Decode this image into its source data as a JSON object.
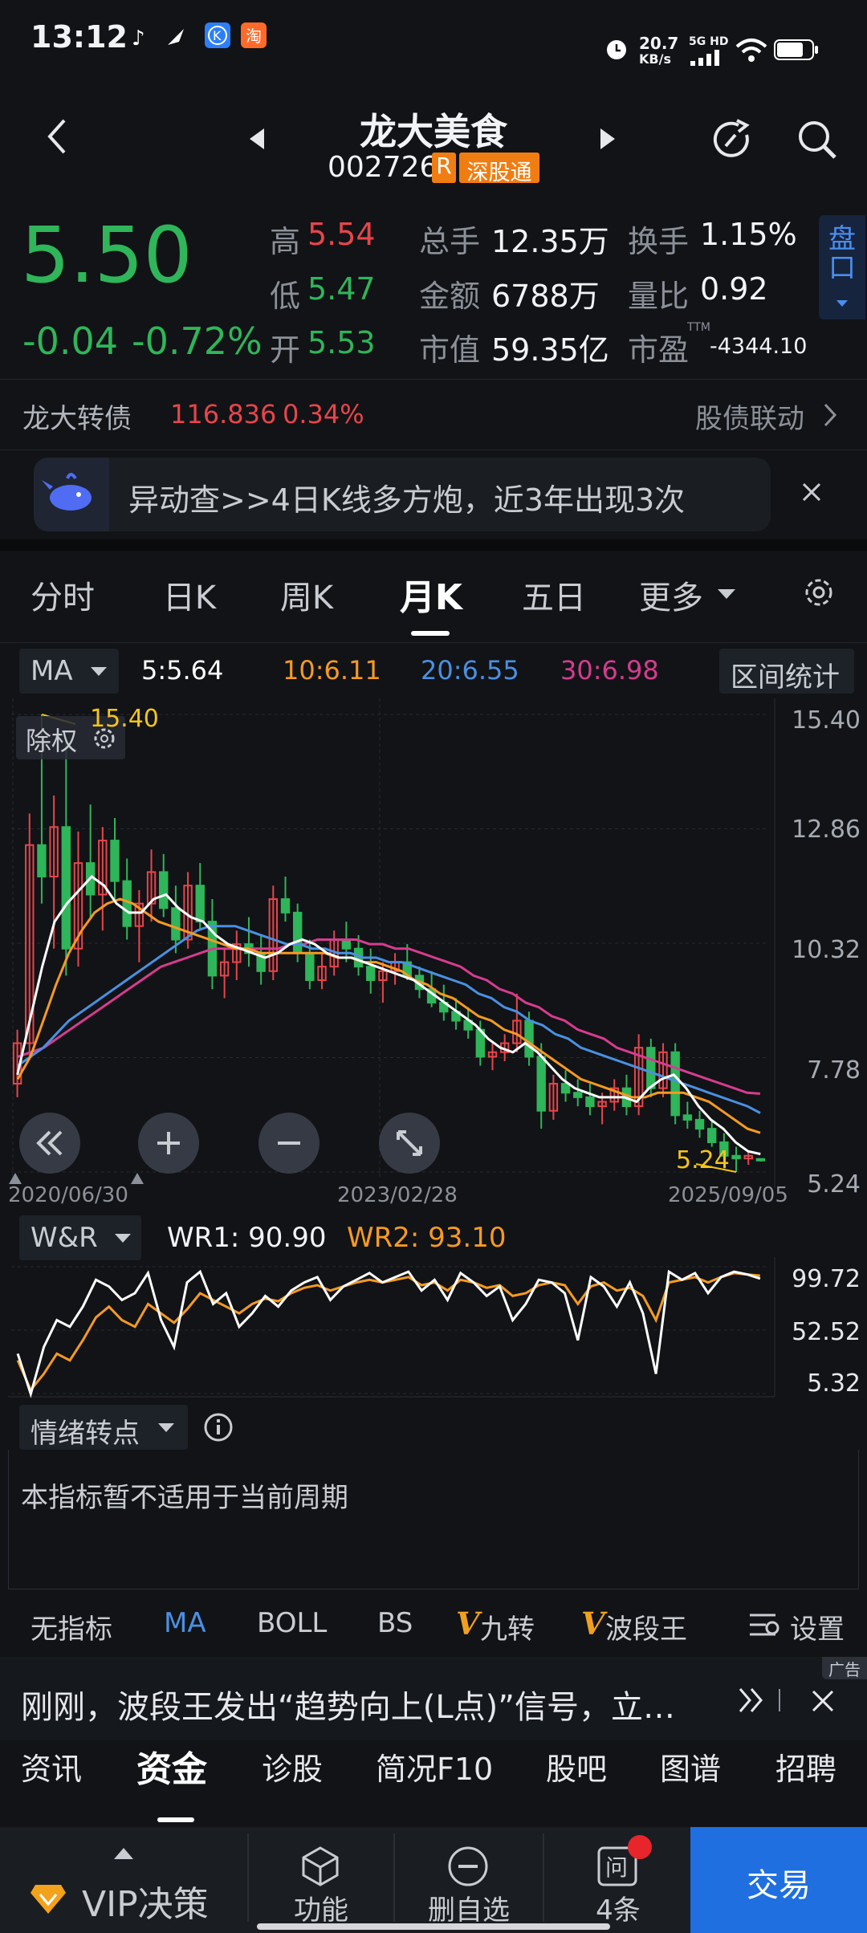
{
  "status_bar": {
    "time": "13:12",
    "net_speed_top": "20.7",
    "net_speed_bottom": "KB/s",
    "net_type": "5G HD",
    "icons": [
      "tiktok-icon",
      "feather-icon",
      "k-app-icon",
      "taobao-icon",
      "alarm-icon",
      "signal-icon",
      "wifi-icon",
      "battery-icon"
    ]
  },
  "header": {
    "name": "龙大美食",
    "code": "002726",
    "badge_r": "R",
    "badge_connect": "深股通"
  },
  "quote": {
    "price": "5.50",
    "change": "-0.04",
    "change_pct": "-0.72%",
    "high_label": "高",
    "high": "5.54",
    "low_label": "低",
    "low": "5.47",
    "open_label": "开",
    "open": "5.53",
    "volume_label": "总手",
    "volume": "12.35万",
    "amount_label": "金额",
    "amount": "6788万",
    "cap_label": "市值",
    "cap": "59.35亿",
    "turnover_label": "换手",
    "turnover": "1.15%",
    "vol_ratio_label": "量比",
    "vol_ratio": "0.92",
    "pe_label": "市盈",
    "pe_sup": "TTM",
    "pe": "-4344.10",
    "side_tab": "盘口"
  },
  "bond": {
    "name": "龙大转债",
    "price": "116.836",
    "pct": "0.34%",
    "link": "股债联动"
  },
  "alert": {
    "text": "异动查>>4日K线多方炮，近3年出现3次"
  },
  "period_tabs": [
    "分时",
    "日K",
    "周K",
    "月K",
    "五日",
    "更多"
  ],
  "active_tab": "月K",
  "ma_bar": {
    "selector": "MA",
    "ma5": "5:5.64",
    "ma10": "10:6.11",
    "ma20": "20:6.55",
    "ma30": "30:6.98",
    "range_stats": "区间统计"
  },
  "chart_overlay": {
    "adjust": "除权",
    "max_label": "15.40",
    "min_label": "5.24"
  },
  "chart_data": [
    {
      "type": "candlestick",
      "x": [
        "2020/06/30",
        "2023/02/28",
        "2025/09/05"
      ],
      "y_ticks": [
        "15.40",
        "12.86",
        "10.32",
        "7.78",
        "5.24"
      ],
      "ylim": [
        5.24,
        15.4
      ],
      "candles": [
        {
          "o": 7.2,
          "h": 8.4,
          "l": 6.9,
          "c": 8.1
        },
        {
          "o": 8.1,
          "h": 13.2,
          "l": 7.8,
          "c": 12.5
        },
        {
          "o": 12.5,
          "h": 15.4,
          "l": 11.2,
          "c": 11.8
        },
        {
          "o": 11.8,
          "h": 13.6,
          "l": 10.2,
          "c": 12.9
        },
        {
          "o": 12.9,
          "h": 14.9,
          "l": 9.6,
          "c": 10.2
        },
        {
          "o": 10.2,
          "h": 12.8,
          "l": 9.8,
          "c": 12.1
        },
        {
          "o": 12.1,
          "h": 13.4,
          "l": 10.9,
          "c": 11.4
        },
        {
          "o": 11.4,
          "h": 12.9,
          "l": 10.6,
          "c": 12.6
        },
        {
          "o": 12.6,
          "h": 13.1,
          "l": 11.3,
          "c": 11.7
        },
        {
          "o": 11.7,
          "h": 12.2,
          "l": 10.4,
          "c": 10.7
        },
        {
          "o": 10.7,
          "h": 11.5,
          "l": 9.9,
          "c": 11.2
        },
        {
          "o": 11.2,
          "h": 12.4,
          "l": 10.8,
          "c": 11.9
        },
        {
          "o": 11.9,
          "h": 12.3,
          "l": 10.9,
          "c": 11.1
        },
        {
          "o": 11.1,
          "h": 11.6,
          "l": 10.1,
          "c": 10.4
        },
        {
          "o": 10.4,
          "h": 11.9,
          "l": 10.2,
          "c": 11.6
        },
        {
          "o": 11.6,
          "h": 12.1,
          "l": 10.6,
          "c": 10.8
        },
        {
          "o": 10.8,
          "h": 11.3,
          "l": 9.3,
          "c": 9.6
        },
        {
          "o": 9.6,
          "h": 10.2,
          "l": 9.1,
          "c": 9.9
        },
        {
          "o": 9.9,
          "h": 10.6,
          "l": 9.5,
          "c": 10.3
        },
        {
          "o": 10.3,
          "h": 10.9,
          "l": 9.8,
          "c": 10.1
        },
        {
          "o": 10.1,
          "h": 10.5,
          "l": 9.4,
          "c": 9.7
        },
        {
          "o": 9.7,
          "h": 11.6,
          "l": 9.5,
          "c": 11.3
        },
        {
          "o": 11.3,
          "h": 11.8,
          "l": 10.8,
          "c": 11.0
        },
        {
          "o": 11.0,
          "h": 11.2,
          "l": 9.9,
          "c": 10.1
        },
        {
          "o": 10.1,
          "h": 10.4,
          "l": 9.3,
          "c": 9.5
        },
        {
          "o": 9.5,
          "h": 10.1,
          "l": 9.3,
          "c": 9.8
        },
        {
          "o": 9.8,
          "h": 10.6,
          "l": 9.6,
          "c": 10.4
        },
        {
          "o": 10.4,
          "h": 10.8,
          "l": 9.9,
          "c": 10.2
        },
        {
          "o": 10.2,
          "h": 10.5,
          "l": 9.6,
          "c": 9.8
        },
        {
          "o": 9.8,
          "h": 10.2,
          "l": 9.2,
          "c": 9.5
        },
        {
          "o": 9.5,
          "h": 9.9,
          "l": 9.0,
          "c": 9.7
        },
        {
          "o": 9.7,
          "h": 10.1,
          "l": 9.4,
          "c": 9.9
        },
        {
          "o": 9.9,
          "h": 10.3,
          "l": 9.5,
          "c": 9.6
        },
        {
          "o": 9.6,
          "h": 9.8,
          "l": 9.1,
          "c": 9.3
        },
        {
          "o": 9.3,
          "h": 9.7,
          "l": 8.9,
          "c": 9.0
        },
        {
          "o": 9.0,
          "h": 9.4,
          "l": 8.6,
          "c": 8.8
        },
        {
          "o": 8.8,
          "h": 9.1,
          "l": 8.4,
          "c": 8.6
        },
        {
          "o": 8.6,
          "h": 8.9,
          "l": 8.2,
          "c": 8.4
        },
        {
          "o": 8.4,
          "h": 8.6,
          "l": 7.6,
          "c": 7.8
        },
        {
          "o": 7.8,
          "h": 8.1,
          "l": 7.5,
          "c": 7.9
        },
        {
          "o": 7.9,
          "h": 8.3,
          "l": 7.7,
          "c": 8.1
        },
        {
          "o": 8.1,
          "h": 9.2,
          "l": 7.9,
          "c": 8.6
        },
        {
          "o": 8.6,
          "h": 8.8,
          "l": 7.6,
          "c": 7.8
        },
        {
          "o": 7.8,
          "h": 8.1,
          "l": 6.2,
          "c": 6.6
        },
        {
          "o": 6.6,
          "h": 7.4,
          "l": 6.4,
          "c": 7.2
        },
        {
          "o": 7.2,
          "h": 7.5,
          "l": 6.8,
          "c": 7.0
        },
        {
          "o": 7.0,
          "h": 7.3,
          "l": 6.7,
          "c": 6.9
        },
        {
          "o": 6.9,
          "h": 7.2,
          "l": 6.5,
          "c": 6.7
        },
        {
          "o": 6.7,
          "h": 7.0,
          "l": 6.3,
          "c": 6.8
        },
        {
          "o": 6.8,
          "h": 7.3,
          "l": 6.6,
          "c": 7.1
        },
        {
          "o": 7.1,
          "h": 7.4,
          "l": 6.5,
          "c": 6.7
        },
        {
          "o": 6.7,
          "h": 8.3,
          "l": 6.5,
          "c": 8.0
        },
        {
          "o": 8.0,
          "h": 8.2,
          "l": 6.9,
          "c": 7.1
        },
        {
          "o": 7.1,
          "h": 8.1,
          "l": 6.9,
          "c": 7.9
        },
        {
          "o": 7.9,
          "h": 8.1,
          "l": 6.3,
          "c": 6.5
        },
        {
          "o": 6.5,
          "h": 6.8,
          "l": 6.2,
          "c": 6.4
        },
        {
          "o": 6.4,
          "h": 6.6,
          "l": 6.0,
          "c": 6.2
        },
        {
          "o": 6.2,
          "h": 6.4,
          "l": 5.8,
          "c": 5.9
        },
        {
          "o": 5.9,
          "h": 6.1,
          "l": 5.5,
          "c": 5.6
        },
        {
          "o": 5.6,
          "h": 5.8,
          "l": 5.24,
          "c": 5.54
        },
        {
          "o": 5.54,
          "h": 5.7,
          "l": 5.4,
          "c": 5.6
        },
        {
          "o": 5.53,
          "h": 5.54,
          "l": 5.47,
          "c": 5.5
        }
      ],
      "ma5": [
        7.4,
        8.6,
        9.8,
        10.8,
        11.2,
        11.5,
        11.8,
        11.6,
        11.2,
        11.0,
        11.0,
        11.3,
        11.4,
        11.1,
        10.9,
        10.8,
        10.5,
        10.3,
        10.2,
        10.1,
        10.0,
        10.1,
        10.3,
        10.4,
        10.3,
        10.1,
        10.0,
        10.0,
        9.9,
        9.8,
        9.7,
        9.6,
        9.5,
        9.3,
        9.1,
        8.9,
        8.7,
        8.5,
        8.2,
        8.0,
        7.9,
        8.1,
        7.9,
        7.6,
        7.3,
        7.1,
        7.0,
        6.9,
        6.9,
        6.9,
        6.8,
        7.1,
        7.3,
        7.4,
        7.1,
        6.7,
        6.4,
        6.2,
        5.9,
        5.7,
        5.64
      ],
      "ma10": [
        7.3,
        7.8,
        8.6,
        9.4,
        10.1,
        10.6,
        11.0,
        11.2,
        11.3,
        11.2,
        11.0,
        10.8,
        10.7,
        10.6,
        10.5,
        10.4,
        10.3,
        10.2,
        10.2,
        10.1,
        10.1,
        10.1,
        10.1,
        10.1,
        10.1,
        10.0,
        10.0,
        9.9,
        9.9,
        9.8,
        9.7,
        9.5,
        9.4,
        9.2,
        9.1,
        8.9,
        8.7,
        8.6,
        8.4,
        8.3,
        8.1,
        7.9,
        7.7,
        7.5,
        7.3,
        7.2,
        7.1,
        7.0,
        6.9,
        6.9,
        7.0,
        7.0,
        7.0,
        6.9,
        6.8,
        6.6,
        6.4,
        6.2,
        6.11
      ],
      "ma20": [
        7.6,
        7.8,
        8.0,
        8.3,
        8.6,
        8.8,
        9.0,
        9.2,
        9.4,
        9.6,
        9.8,
        10.0,
        10.2,
        10.4,
        10.6,
        10.7,
        10.7,
        10.7,
        10.6,
        10.5,
        10.4,
        10.3,
        10.3,
        10.2,
        10.2,
        10.1,
        10.1,
        10.0,
        10.0,
        9.9,
        9.9,
        9.8,
        9.7,
        9.6,
        9.5,
        9.4,
        9.2,
        9.1,
        8.9,
        8.8,
        8.6,
        8.5,
        8.3,
        8.2,
        8.0,
        7.9,
        7.8,
        7.7,
        7.6,
        7.5,
        7.4,
        7.3,
        7.2,
        7.1,
        7.0,
        6.9,
        6.8,
        6.7,
        6.55
      ],
      "ma30": [
        7.8,
        7.9,
        8.0,
        8.2,
        8.4,
        8.6,
        8.8,
        9.0,
        9.2,
        9.4,
        9.6,
        9.8,
        9.9,
        10.0,
        10.1,
        10.2,
        10.2,
        10.2,
        10.2,
        10.2,
        10.2,
        10.3,
        10.3,
        10.4,
        10.4,
        10.4,
        10.4,
        10.3,
        10.3,
        10.2,
        10.2,
        10.1,
        10.0,
        9.9,
        9.8,
        9.6,
        9.5,
        9.3,
        9.2,
        9.0,
        8.9,
        8.7,
        8.6,
        8.4,
        8.3,
        8.2,
        8.0,
        7.9,
        7.8,
        7.7,
        7.6,
        7.5,
        7.4,
        7.3,
        7.2,
        7.1,
        7.0,
        6.98
      ]
    },
    {
      "type": "line",
      "name": "W&R",
      "y_ticks": [
        "99.72",
        "52.52",
        "5.32"
      ],
      "ylim": [
        5.32,
        99.72
      ],
      "series": [
        {
          "name": "WR1: 90.90",
          "values": [
            35,
            5,
            40,
            60,
            55,
            70,
            90,
            85,
            75,
            80,
            95,
            60,
            40,
            88,
            96,
            72,
            80,
            55,
            65,
            78,
            70,
            82,
            88,
            92,
            75,
            85,
            90,
            95,
            88,
            92,
            96,
            82,
            90,
            75,
            95,
            88,
            78,
            85,
            60,
            72,
            90,
            88,
            80,
            45,
            92,
            85,
            70,
            88,
            65,
            20,
            96,
            90,
            95,
            80,
            92,
            96,
            94,
            90.9
          ]
        },
        {
          "name": "WR2: 93.10",
          "values": [
            30,
            8,
            20,
            35,
            30,
            45,
            62,
            70,
            60,
            55,
            72,
            65,
            58,
            68,
            80,
            75,
            70,
            65,
            72,
            76,
            74,
            80,
            84,
            86,
            82,
            85,
            88,
            90,
            88,
            90,
            92,
            86,
            88,
            82,
            90,
            88,
            84,
            86,
            78,
            80,
            86,
            88,
            86,
            72,
            85,
            88,
            82,
            84,
            78,
            60,
            88,
            90,
            92,
            88,
            92,
            95,
            94,
            93.1
          ]
        }
      ]
    }
  ],
  "chart_misc": {
    "date_left": "2020/06/30",
    "date_mid": "2023/02/28",
    "date_right": "2025/09/05"
  },
  "wr_bar": {
    "selector": "W&R",
    "wr1": "WR1: 90.90",
    "wr2": "WR2: 93.10"
  },
  "emotion": {
    "selector": "情绪转点",
    "message": "本指标暂不适用于当前周期"
  },
  "indicator_tabs": {
    "none": "无指标",
    "ma": "MA",
    "boll": "BOLL",
    "bs": "BS",
    "jiuzhuan": "九转",
    "boduan": "波段王",
    "settings": "设置"
  },
  "ad": {
    "badge": "广告",
    "text": "刚刚，波段王发出“趋势向上(L点)”信号，立…"
  },
  "bottom_tabs": [
    "资讯",
    "资金",
    "诊股",
    "简况F10",
    "股吧",
    "图谱",
    "招聘"
  ],
  "bottom_active": "资金",
  "bottom_bar": {
    "vip": "VIP决策",
    "func": "功能",
    "remove": "删自选",
    "ask": "4条",
    "trade": "交易"
  },
  "colors": {
    "up": "#e8454b",
    "down": "#2fb55a",
    "ma5": "#ffffff",
    "ma10": "#f59a23",
    "ma20": "#4a90e2",
    "ma30": "#d63c8f",
    "accent": "#1f6fe0"
  }
}
